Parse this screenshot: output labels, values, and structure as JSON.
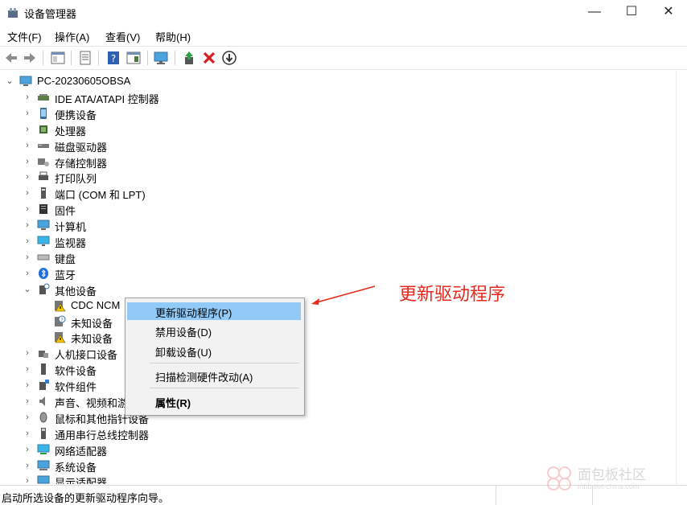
{
  "window": {
    "title": "设备管理器",
    "minimize": "—",
    "maximize": "☐",
    "close": "✕"
  },
  "menu": [
    "文件(F)",
    "操作(A)",
    "查看(V)",
    "帮助(H)"
  ],
  "toolbar": {
    "buttons": [
      "back-icon",
      "forward-icon",
      "properties-icon",
      "document-icon",
      "help-icon",
      "view-icon",
      "monitor-icon",
      "update-driver-icon",
      "uninstall-icon",
      "download-icon"
    ]
  },
  "tree": {
    "root": "PC-20230605OBSA",
    "items": [
      {
        "label": "IDE ATA/ATAPI 控制器",
        "icon": "ide-icon"
      },
      {
        "label": "便携设备",
        "icon": "portable-device-icon"
      },
      {
        "label": "处理器",
        "icon": "processor-icon"
      },
      {
        "label": "磁盘驱动器",
        "icon": "disk-icon"
      },
      {
        "label": "存储控制器",
        "icon": "storage-icon"
      },
      {
        "label": "打印队列",
        "icon": "printer-icon"
      },
      {
        "label": "端口 (COM 和 LPT)",
        "icon": "port-icon"
      },
      {
        "label": "固件",
        "icon": "firmware-icon"
      },
      {
        "label": "计算机",
        "icon": "computer-icon"
      },
      {
        "label": "监视器",
        "icon": "monitor-icon"
      },
      {
        "label": "键盘",
        "icon": "keyboard-icon"
      },
      {
        "label": "蓝牙",
        "icon": "bluetooth-icon"
      },
      {
        "label": "其他设备",
        "icon": "other-device-icon"
      },
      {
        "label": "人机接口设备",
        "icon": "hid-icon"
      },
      {
        "label": "软件设备",
        "icon": "software-device-icon"
      },
      {
        "label": "软件组件",
        "icon": "software-component-icon"
      },
      {
        "label": "声音、视频和游",
        "icon": "sound-icon"
      },
      {
        "label": "鼠标和其他指针设备",
        "icon": "mouse-icon"
      },
      {
        "label": "通用串行总线控制器",
        "icon": "usb-icon"
      },
      {
        "label": "网络适配器",
        "icon": "network-icon"
      },
      {
        "label": "系统设备",
        "icon": "system-icon"
      },
      {
        "label": "显示适配器",
        "icon": "display-icon"
      }
    ],
    "other_children": [
      {
        "label": "CDC NCM",
        "icon": "warning-device-icon"
      },
      {
        "label": "未知设备",
        "icon": "unknown-device-icon"
      },
      {
        "label": "未知设备",
        "icon": "warning-device-icon"
      }
    ]
  },
  "context_menu": {
    "items": [
      {
        "label": "更新驱动程序(P)"
      },
      {
        "label": "禁用设备(D)"
      },
      {
        "label": "卸载设备(U)"
      },
      {
        "label": "扫描检测硬件改动(A)"
      },
      {
        "label": "属性(R)"
      }
    ]
  },
  "annotation": "更新驱动程序",
  "status": "启动所选设备的更新驱动程序向导。",
  "watermark": {
    "title": "面包板社区",
    "sub": "mbb.eet-china.com"
  },
  "colors": {
    "highlight": "#91c9f7",
    "annotation": "#e8291c",
    "warning": "#f5c400"
  }
}
